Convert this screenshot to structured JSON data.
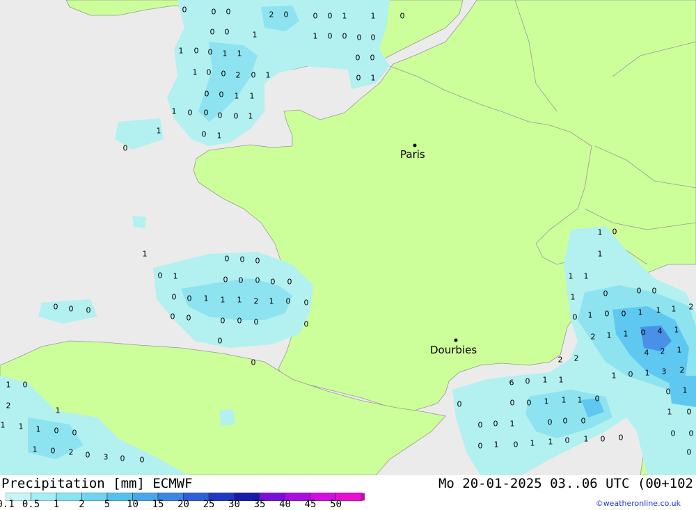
{
  "map": {
    "cities": [
      {
        "name": "Paris"
      },
      {
        "name": "Dourbies"
      }
    ],
    "colors": {
      "sea": "#ebebeb",
      "land": "#ccff99",
      "border": "#999999",
      "precip_light": "#b3f0f0",
      "precip_medium": "#8ee3f0",
      "precip_heavy": "#5fc8f0",
      "precip_peak": "#4a90e8"
    },
    "precip_labels": [
      "0",
      "0",
      "0",
      "2",
      "0",
      "0",
      "0",
      "1",
      "1",
      "0",
      "0",
      "0",
      "1",
      "1",
      "0",
      "0",
      "0",
      "0",
      "1",
      "0",
      "0",
      "1",
      "1",
      "0",
      "0",
      "1",
      "0",
      "0",
      "2",
      "0",
      "1",
      "0",
      "1",
      "0",
      "0",
      "1",
      "1",
      "1",
      "0",
      "0",
      "0",
      "0",
      "1",
      "1",
      "0",
      "1",
      "0",
      "1",
      "0",
      "1",
      "1",
      "0",
      "0",
      "0",
      "0",
      "1",
      "0",
      "0",
      "0",
      "0",
      "0",
      "1",
      "1",
      "0",
      "0",
      "1",
      "1",
      "1",
      "2",
      "1",
      "0",
      "0",
      "0",
      "0",
      "0",
      "0",
      "0",
      "0",
      "0",
      "0",
      "0",
      "0",
      "0",
      "0",
      "0",
      "0",
      "1",
      "0",
      "1",
      "0",
      "0",
      "1",
      "1",
      "1",
      "2",
      "2",
      "1",
      "1",
      "0",
      "4",
      "1",
      "4",
      "2",
      "1",
      "2",
      "2",
      "1",
      "0",
      "1",
      "3",
      "2",
      "1",
      "0",
      "6",
      "0",
      "1",
      "1",
      "0",
      "1",
      "0",
      "0",
      "0",
      "1",
      "1",
      "1",
      "0",
      "1",
      "2",
      "1",
      "0",
      "1",
      "1",
      "1",
      "0",
      "0",
      "0",
      "0",
      "1",
      "0",
      "0",
      "0",
      "0",
      "0",
      "1",
      "0",
      "2",
      "0",
      "3",
      "0",
      "0",
      "0",
      "0",
      "1",
      "0",
      "1",
      "1",
      "0",
      "1",
      "0",
      "0"
    ]
  },
  "legend": {
    "title": "Precipitation [mm] ECMWF",
    "ticks": [
      "0.1",
      "0.5",
      "1",
      "2",
      "5",
      "10",
      "15",
      "20",
      "25",
      "30",
      "35",
      "40",
      "45",
      "50"
    ],
    "colors": [
      "#c8f5f5",
      "#a6eef5",
      "#8ae3f0",
      "#6fd5ee",
      "#55c2ee",
      "#4aa6ea",
      "#3d86e2",
      "#2e5fd6",
      "#1f39c2",
      "#1a1aa8",
      "#7a10d8",
      "#a710e0",
      "#d010e0",
      "#e810d0",
      "#c010b0"
    ]
  },
  "run_info": "Mo 20-01-2025 03..06 UTC (00+102",
  "credit": "©weatheronline.co.uk"
}
